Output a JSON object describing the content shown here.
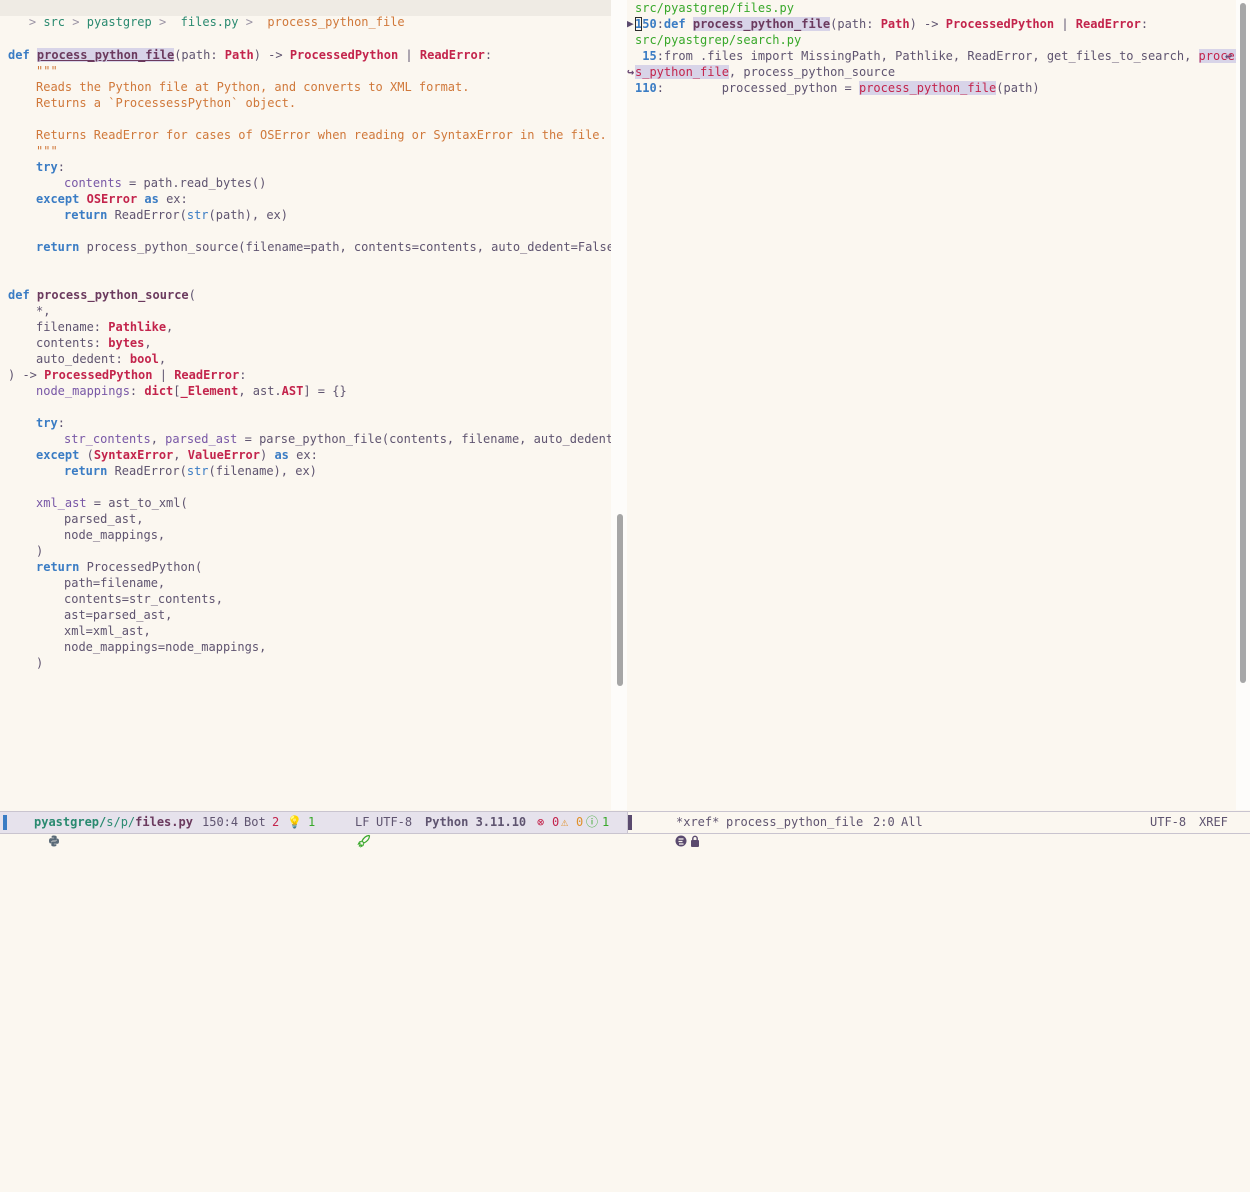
{
  "breadcrumb": {
    "items": [
      "src",
      "pyastgrep",
      "files.py",
      "process_python_file"
    ],
    "separator": ">"
  },
  "left_code": {
    "l1": {
      "kw": "def",
      "fn": "process_python_file",
      "a": "(path: ",
      "t1": "Path",
      "b": ") -> ",
      "t2": "ProcessedPython",
      "c": " | ",
      "t3": "ReadError",
      "d": ":"
    },
    "doc_open": "\"\"\"",
    "doc1": "Reads the Python file at Python, and converts to XML format.",
    "doc2": "Returns a `ProcessessPython` object.",
    "doc3": "Returns ReadError for cases of OSError when reading or SyntaxError in the file.",
    "doc_close": "\"\"\"",
    "try": "try",
    "colon": ":",
    "l_contents_var": "contents",
    "l_contents_rest": " = path.read_bytes()",
    "except": "except",
    "oserror": "OSError",
    "as": "as",
    "ex": " ex:",
    "return": "return",
    "readerror_call": " ReadError(",
    "str": "str",
    "path_ex": "(path), ex)",
    "ret_src": " process_python_source(filename=path, contents=contents, auto_dedent=False)",
    "def": "def",
    "fn2": "process_python_source",
    "paren": "(",
    "star": "*,",
    "filename_arg": "filename: ",
    "pathlike": "Pathlike",
    "comma": ",",
    "contents_arg": "contents: ",
    "bytes": "bytes",
    "dedent_arg": "auto_dedent: ",
    "bool": "bool",
    "ret_sig_a": ") -> ",
    "processed": "ProcessedPython",
    "pipe": " | ",
    "readerror": "ReadError",
    "nm_var": "node_mappings",
    "nm_a": ": ",
    "dict": "dict",
    "nm_b": "[",
    "elem": "_Element",
    "nm_c": ", ast.",
    "ast": "AST",
    "nm_d": "] = {}",
    "sc_var1": "str_contents",
    "sc_mid": ", ",
    "sc_var2": "parsed_ast",
    "sc_rest": " = parse_python_file(contents, filename, auto_dedent=",
    "trunc_arrow": "→",
    "exc_open": " (",
    "syntaxerror": "SyntaxError",
    "valueerror": "ValueError",
    "exc_close": ") ",
    "fname_ex": "(filename), ex)",
    "xml_var": "xml_ast",
    "xml_rest": " = ast_to_xml(",
    "parsed_ast_arg": "parsed_ast,",
    "node_mappings_arg": "node_mappings,",
    "close_paren": ")",
    "ret_pp": " ProcessedPython(",
    "kw_path": "path=filename,",
    "kw_contents": "contents=str_contents,",
    "kw_ast": "ast=parsed_ast,",
    "kw_xml": "xml=xml_ast,",
    "kw_nm": "node_mappings=node_mappings,"
  },
  "xref": {
    "file1": "src/pyastgrep/files.py",
    "r1_num_cursor": "1",
    "r1_num_rest": "50",
    "r1_colon": ":",
    "r1_def": "def",
    "r1_fn": "process_python_file",
    "r1_a": "(path: ",
    "r1_path": "Path",
    "r1_b": ") -> ",
    "r1_pp": "ProcessedPython",
    "r1_c": " | ",
    "r1_re": "ReadError",
    "r1_d": ":",
    "file2": "src/pyastgrep/search.py",
    "r2_num": " 15",
    "r2_text": ":from .files import MissingPath, Pathlike, ReadError, get_files_to_search, ",
    "r2_ref_a": "proces",
    "r2_ref_b": "s_python_file",
    "r2_rest": ", process_python_source",
    "r3_num": "110",
    "r3_text": ":        processed_python = ",
    "r3_ref": "process_python_file",
    "r3_rest": "(path)",
    "wrap_right": "↩",
    "wrap_left": "↪"
  },
  "modeline_left": {
    "project": "pyastgrep/",
    "path_mid": "s/p/",
    "file": "files.py",
    "position": "150:4",
    "scroll": "Bot",
    "count_red": "2",
    "hint_count": "1",
    "eol": "LF",
    "encoding": "UTF-8",
    "lang": "Python 3.11.10",
    "errors": "0",
    "warnings": "0",
    "infos": "1"
  },
  "modeline_right": {
    "buffer": "*xref*",
    "target": "process_python_file",
    "position": "2:0",
    "scroll": "All",
    "encoding": "UTF-8",
    "mode": "XREF"
  }
}
